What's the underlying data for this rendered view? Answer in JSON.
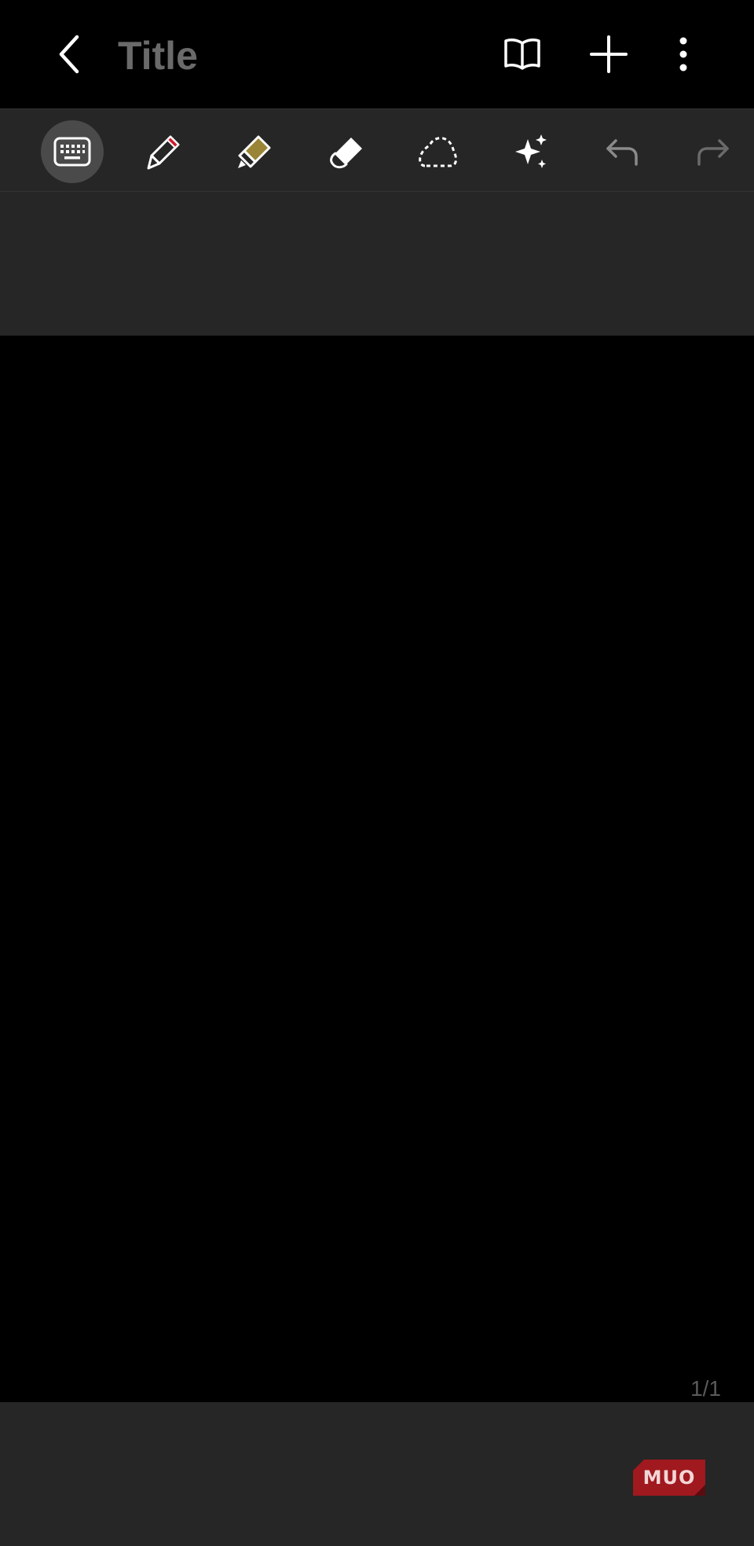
{
  "app_bar": {
    "title": "Title",
    "icons": {
      "back": "back-arrow-icon",
      "reading_mode": "book-icon",
      "add": "plus-icon",
      "more": "more-vertical-icon"
    }
  },
  "toolbar": {
    "tools": [
      {
        "id": "keyboard",
        "icon": "keyboard-icon",
        "active": true
      },
      {
        "id": "pen",
        "icon": "pen-icon",
        "active": false
      },
      {
        "id": "highlighter",
        "icon": "highlighter-icon",
        "active": false
      },
      {
        "id": "eraser",
        "icon": "eraser-icon",
        "active": false
      },
      {
        "id": "lasso",
        "icon": "lasso-select-icon",
        "active": false
      },
      {
        "id": "ai",
        "icon": "sparkle-icon",
        "active": false
      },
      {
        "id": "undo",
        "icon": "undo-icon",
        "active": false
      },
      {
        "id": "redo",
        "icon": "redo-icon",
        "active": false
      }
    ],
    "colors": {
      "pen_tip": "#d01c2e",
      "highlighter_body": "#9a8436",
      "active_bg": "#4a4a4a"
    }
  },
  "canvas": {
    "page_indicator": "1/1"
  },
  "watermark": {
    "text": "MUO",
    "color": "#a0191f"
  }
}
